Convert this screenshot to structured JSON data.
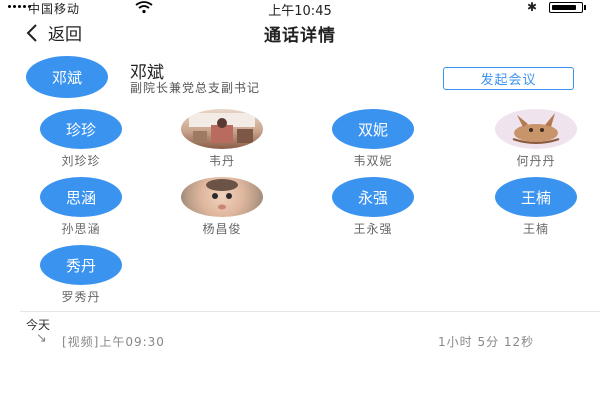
{
  "status_bar": {
    "carrier": "中国移动",
    "time": "上午10:45",
    "battery_level": 0.85
  },
  "nav": {
    "back_label": "返回",
    "title": "通话详情"
  },
  "host": {
    "avatar_text": "邓斌",
    "name": "邓斌",
    "role": "副院长兼党总支副书记",
    "action_label": "发起会议"
  },
  "members": [
    {
      "avatar_text": "珍珍",
      "name": "刘珍珍",
      "photo": false
    },
    {
      "avatar_text": "",
      "name": "韦丹",
      "photo": true,
      "photo_kind": "room"
    },
    {
      "avatar_text": "双妮",
      "name": "韦双妮",
      "photo": false
    },
    {
      "avatar_text": "",
      "name": "何丹丹",
      "photo": true,
      "photo_kind": "cartoon"
    },
    {
      "avatar_text": "思涵",
      "name": "孙思涵",
      "photo": false
    },
    {
      "avatar_text": "",
      "name": "杨昌俊",
      "photo": true,
      "photo_kind": "baby"
    },
    {
      "avatar_text": "永强",
      "name": "王永强",
      "photo": false
    },
    {
      "avatar_text": "王楠",
      "name": "王楠",
      "photo": false
    },
    {
      "avatar_text": "秀丹",
      "name": "罗秀丹",
      "photo": false
    }
  ],
  "history": {
    "date_label": "今天",
    "record": {
      "direction_icon": "outgoing-call-icon",
      "type_time": "[视频]上午09:30",
      "duration": "1小时 5分 12秒"
    }
  },
  "colors": {
    "accent": "#3b93f0"
  }
}
